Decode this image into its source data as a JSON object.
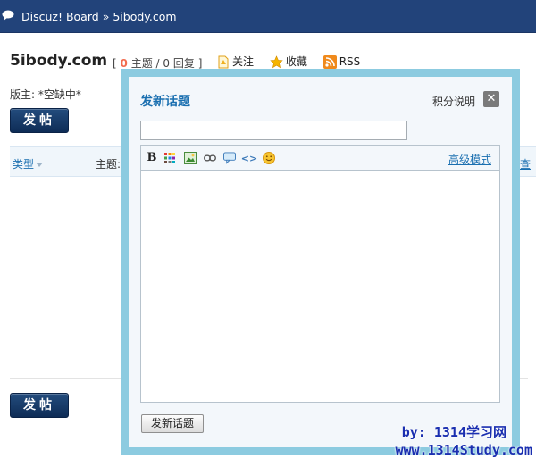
{
  "nav": {
    "breadcrumb_root": "Discuz! Board",
    "separator": "»",
    "breadcrumb_current": "5ibody.com"
  },
  "forum": {
    "name": "5ibody.com",
    "stats_open": "[",
    "topics_count": "0",
    "topics_label": "主题",
    "slash": "/",
    "replies_count": "0",
    "replies_label": "回复",
    "stats_close": "]",
    "follow_label": "关注",
    "favorite_label": "收藏",
    "rss_label": "RSS",
    "moderator_label": "版主: *空缺中*"
  },
  "buttons": {
    "post_top": "发帖",
    "post_bottom": "发帖"
  },
  "table": {
    "col_type": "类型",
    "col_subject": "主题:",
    "col_search": "查"
  },
  "modal": {
    "title": "发新话题",
    "credits_link": "积分说明",
    "close_glyph": "✕",
    "subject_value": "",
    "advanced_mode": "高级模式",
    "submit_label": "发新话题",
    "toolbar_icons": [
      "bold-icon",
      "color-grid-icon",
      "image-icon",
      "link-icon",
      "quote-icon",
      "code-icon",
      "smiley-icon"
    ]
  },
  "colors": {
    "nav_bg": "#22437a",
    "modal_border": "#8ccbe0",
    "link_blue": "#1a6fb0",
    "count_orange": "#f26c4f"
  },
  "watermark": {
    "line1": "by: 1314学习网",
    "line2": "www.1314Study.com"
  }
}
